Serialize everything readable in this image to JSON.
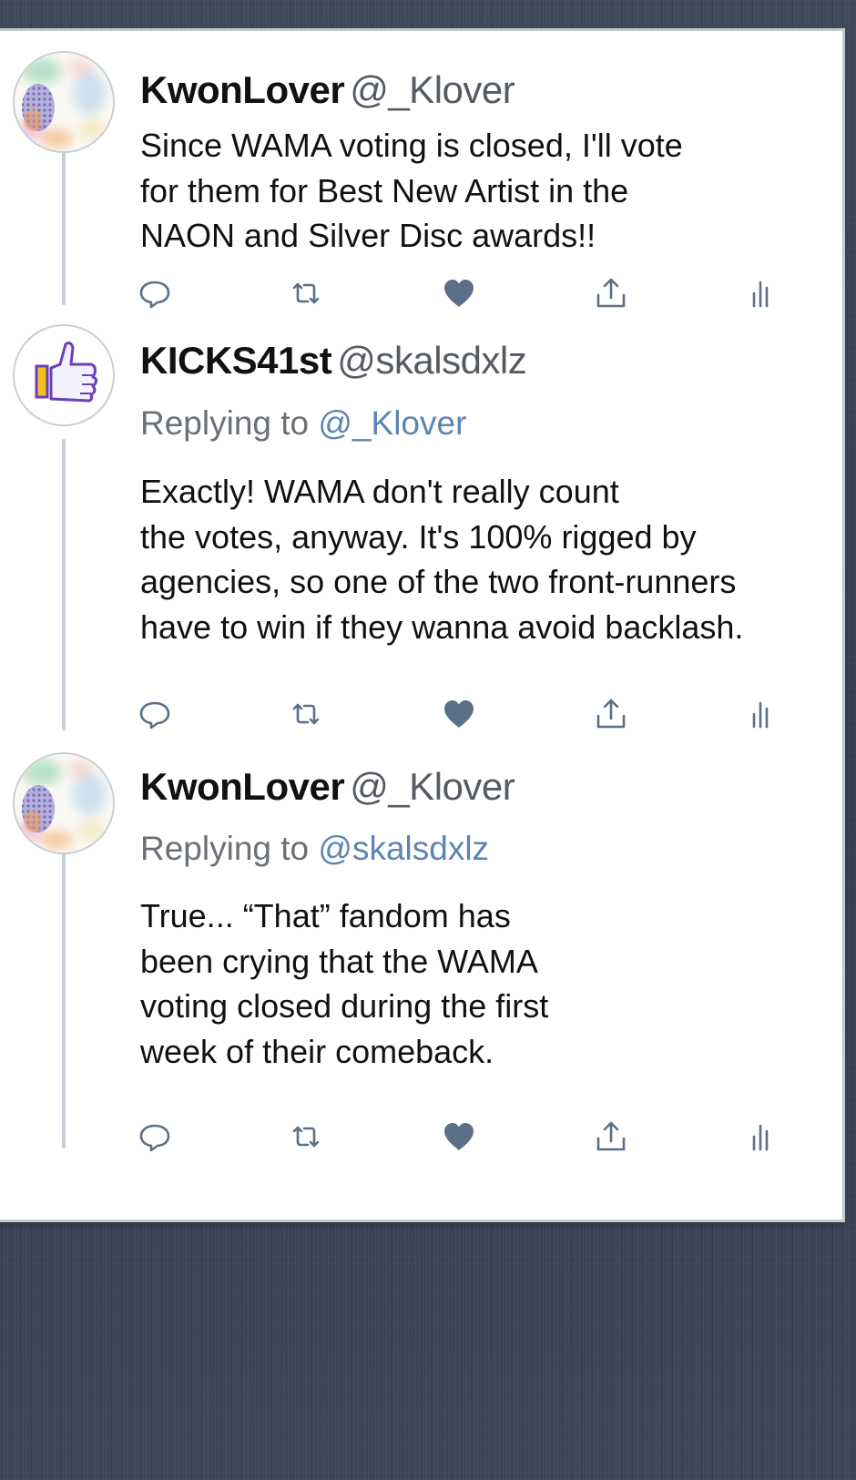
{
  "tweets": [
    {
      "display_name": "KwonLover",
      "handle": "@_Klover",
      "avatar_icon": "watercolor-avatar-icon",
      "replying_to_label": "",
      "replying_to_handle": "",
      "text": "Since WAMA voting is closed, I'll vote\nfor them for Best New Artist in the\nNAON and Silver Disc awards!!"
    },
    {
      "display_name": "KICKS41st",
      "handle": "@skalsdxlz",
      "avatar_icon": "thumbs-up-icon",
      "replying_to_label": "Replying to",
      "replying_to_handle": "@_Klover",
      "text": "Exactly! WAMA don't really count\nthe votes, anyway. It's 100% rigged by\nagencies, so one of the two front-runners\nhave to win if they wanna avoid backlash."
    },
    {
      "display_name": "KwonLover",
      "handle": "@_Klover",
      "avatar_icon": "watercolor-avatar-icon",
      "replying_to_label": "Replying to",
      "replying_to_handle": "@skalsdxlz",
      "text": "True... “That” fandom has\nbeen crying that the WAMA\nvoting closed during the first\nweek of their comeback."
    }
  ],
  "action_icons": [
    "reply-icon",
    "retweet-icon",
    "heart-icon",
    "share-icon",
    "analytics-icon"
  ],
  "colors": {
    "background": "#3a4658",
    "card": "#ffffff",
    "thread_line": "#c6d0da",
    "icon": "#5b7088",
    "mention": "#5c85b2",
    "secondary_text": "#6b7076"
  }
}
